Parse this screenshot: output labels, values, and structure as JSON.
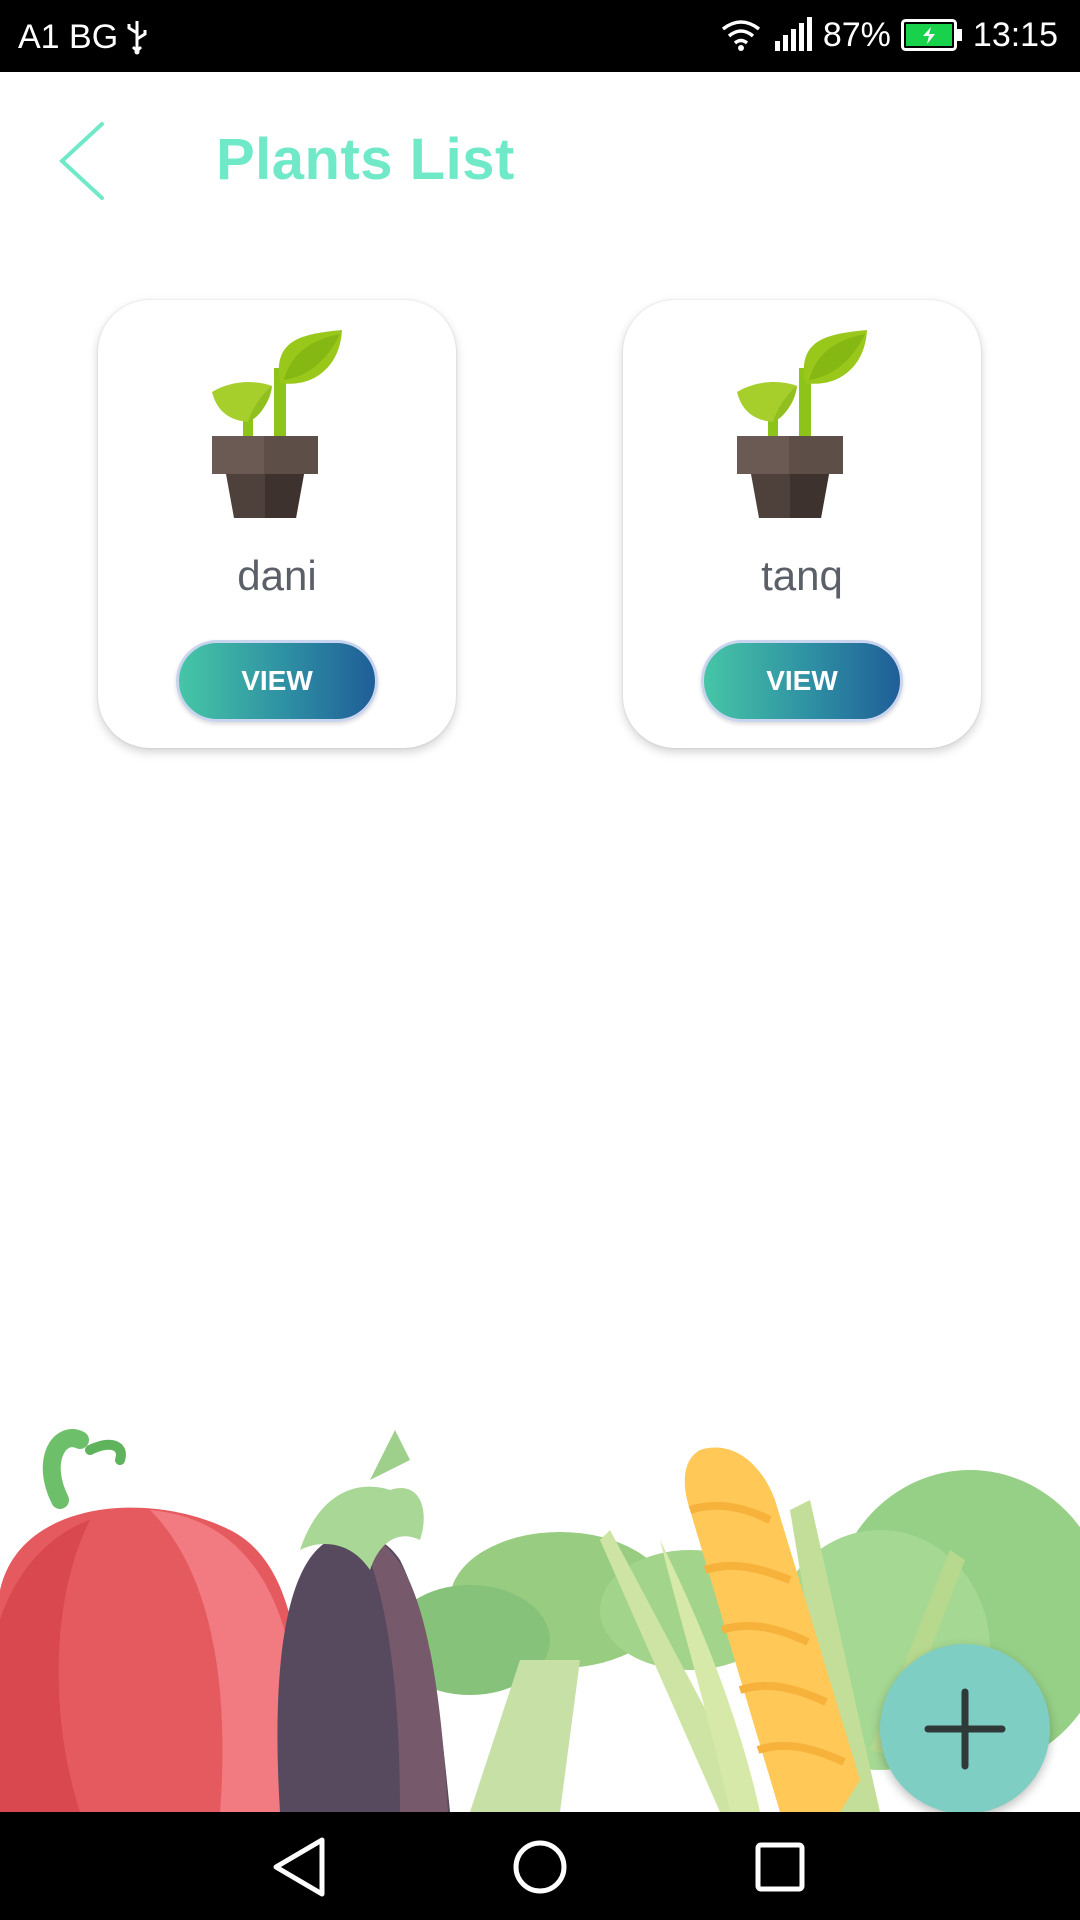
{
  "status_bar": {
    "carrier": "A1 BG",
    "battery_percent": "87%",
    "time": "13:15",
    "icons": [
      "usb-icon",
      "wifi-icon",
      "signal-icon",
      "battery-charging-icon"
    ]
  },
  "header": {
    "title": "Plants List",
    "back_icon": "back-chevron-icon"
  },
  "plants": [
    {
      "name": "dani",
      "button_label": "VIEW",
      "icon": "potted-sprout-icon"
    },
    {
      "name": "tanq",
      "button_label": "VIEW",
      "icon": "potted-sprout-icon"
    }
  ],
  "fab": {
    "icon": "plus-icon"
  },
  "nav_bar": {
    "icons": [
      "nav-back-icon",
      "nav-home-icon",
      "nav-recents-icon"
    ]
  },
  "colors": {
    "title": "#6FE9C8",
    "button_gradient_start": "#46C6A6",
    "button_gradient_end": "#1F5E98",
    "fab": "#7FCEC4"
  }
}
